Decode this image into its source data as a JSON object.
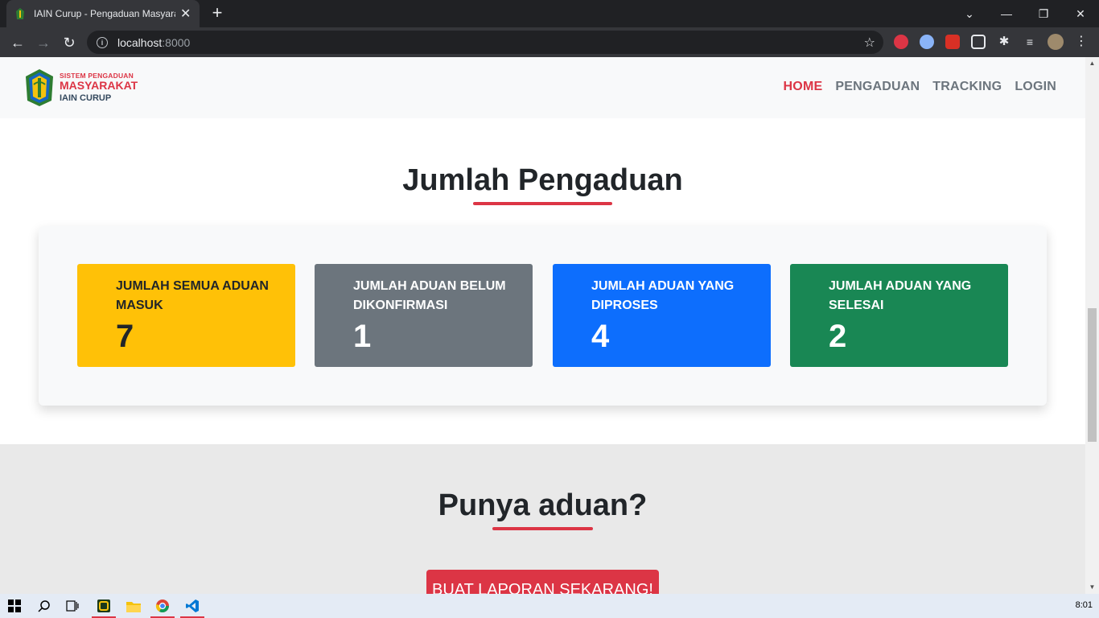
{
  "browser": {
    "tab_title": "IAIN Curup - Pengaduan Masyarakat",
    "url_host": "localhost",
    "url_port": ":8000"
  },
  "site": {
    "logo_line1": "SISTEM PENGADUAN",
    "logo_line2": "MASYARAKAT",
    "logo_line3": "IAIN CURUP",
    "menu": [
      "HOME",
      "PENGADUAN",
      "TRACKING",
      "LOGIN"
    ]
  },
  "stats_section": {
    "title": "Jumlah Pengaduan",
    "items": [
      {
        "label": "JUMLAH SEMUA ADUAN MASUK",
        "value": "7",
        "color": "#ffc107"
      },
      {
        "label": "JUMLAH ADUAN BELUM DIKONFIRMASI",
        "value": "1",
        "color": "#6c757d"
      },
      {
        "label": "JUMLAH ADUAN YANG DIPROSES",
        "value": "4",
        "color": "#0d6efd"
      },
      {
        "label": "JUMLAH ADUAN YANG SELESAI",
        "value": "2",
        "color": "#198754"
      }
    ]
  },
  "cta": {
    "title": "Punya aduan?",
    "button_label": "BUAT LAPORAN SEKARANG!"
  },
  "taskbar": {
    "clock": "8:01"
  }
}
